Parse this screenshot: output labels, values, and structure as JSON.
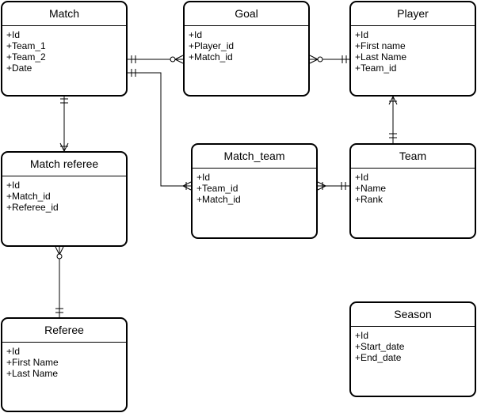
{
  "entities": {
    "match": {
      "title": "Match",
      "attributes": [
        "+Id",
        "+Team_1",
        "+Team_2",
        "+Date"
      ]
    },
    "goal": {
      "title": "Goal",
      "attributes": [
        "+Id",
        "+Player_id",
        "+Match_id"
      ]
    },
    "player": {
      "title": "Player",
      "attributes": [
        "+Id",
        "+First name",
        "+Last Name",
        "+Team_id"
      ]
    },
    "match_referee": {
      "title": "Match referee",
      "attributes": [
        "+Id",
        "+Match_id",
        "+Referee_id"
      ]
    },
    "match_team": {
      "title": "Match_team",
      "attributes": [
        "+Id",
        "+Team_id",
        "+Match_id"
      ]
    },
    "team": {
      "title": "Team",
      "attributes": [
        "+Id",
        "+Name",
        "+Rank"
      ]
    },
    "referee": {
      "title": "Referee",
      "attributes": [
        "+Id",
        "+First Name",
        "+Last Name"
      ]
    },
    "season": {
      "title": "Season",
      "attributes": [
        "+Id",
        "+Start_date",
        "+End_date"
      ]
    }
  },
  "relationships": [
    {
      "from": "match",
      "to": "goal",
      "from_card": "one-and-only-one",
      "to_card": "zero-or-many"
    },
    {
      "from": "player",
      "to": "goal",
      "from_card": "one-and-only-one",
      "to_card": "zero-or-many"
    },
    {
      "from": "team",
      "to": "player",
      "from_card": "one-and-only-one",
      "to_card": "one-or-many"
    },
    {
      "from": "match",
      "to": "match_referee",
      "from_card": "one-and-only-one",
      "to_card": "one-or-many"
    },
    {
      "from": "referee",
      "to": "match_referee",
      "from_card": "one-and-only-one",
      "to_card": "zero-or-many"
    },
    {
      "from": "match",
      "to": "match_team",
      "from_card": "one-and-only-one",
      "to_card": "one-or-many"
    },
    {
      "from": "team",
      "to": "match_team",
      "from_card": "one-and-only-one",
      "to_card": "one-or-many"
    }
  ],
  "colors": {
    "line": "#000000",
    "background": "#ffffff"
  }
}
